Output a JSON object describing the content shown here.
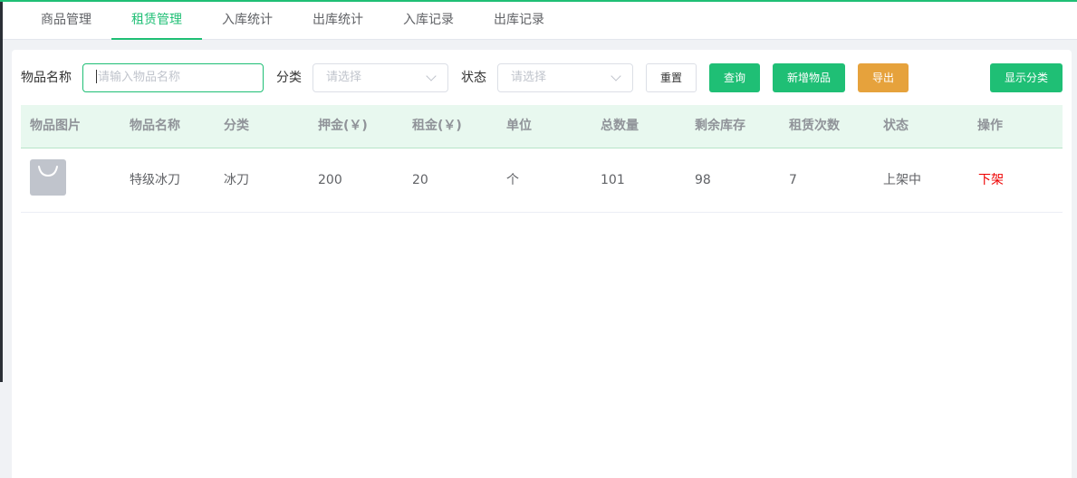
{
  "tabs": [
    {
      "label": "商品管理"
    },
    {
      "label": "租赁管理"
    },
    {
      "label": "入库统计"
    },
    {
      "label": "出库统计"
    },
    {
      "label": "入库记录"
    },
    {
      "label": "出库记录"
    }
  ],
  "active_tab": "租赁管理",
  "filters": {
    "name_label": "物品名称",
    "name_placeholder": "请输入物品名称",
    "category_label": "分类",
    "category_placeholder": "请选择",
    "status_label": "状态",
    "status_placeholder": "请选择"
  },
  "buttons": {
    "reset": "重置",
    "query": "查询",
    "add_item": "新增物品",
    "export": "导出",
    "show_category": "显示分类"
  },
  "table": {
    "headers": [
      "物品图片",
      "物品名称",
      "分类",
      "押金(￥)",
      "租金(￥)",
      "单位",
      "总数量",
      "剩余库存",
      "租赁次数",
      "状态",
      "操作"
    ],
    "rows": [
      {
        "image_icon": "bag-icon",
        "name": "特级冰刀",
        "category": "冰刀",
        "deposit": "200",
        "rent": "20",
        "unit": "个",
        "total": "101",
        "stock": "98",
        "rent_count": "7",
        "status": "上架中",
        "action": "下架"
      }
    ]
  },
  "colors": {
    "accent": "#1fbf75",
    "export": "#e6a23c",
    "danger": "#ee0000",
    "table_header_bg": "#e8f8ef"
  }
}
